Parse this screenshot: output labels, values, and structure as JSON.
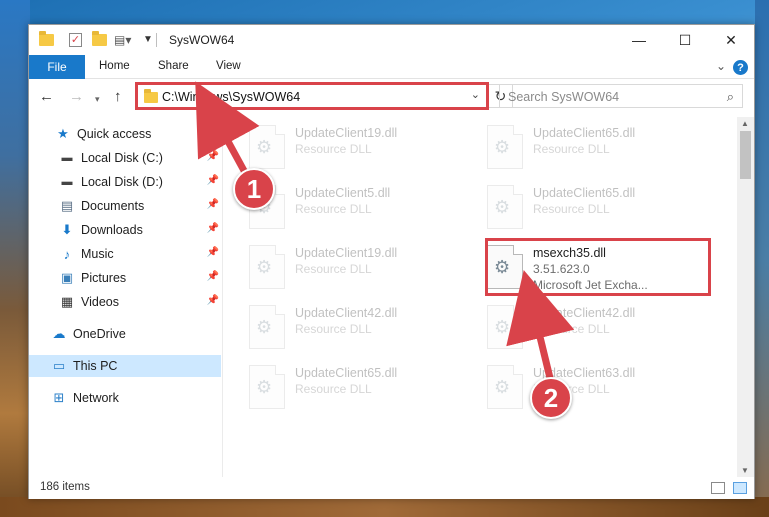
{
  "window": {
    "title": "SysWOW64",
    "controls": {
      "minimize": "—",
      "maximize": "☐",
      "close": "✕"
    }
  },
  "ribbon": {
    "tabs": [
      "File",
      "Home",
      "Share",
      "View"
    ],
    "help": "?"
  },
  "address_bar": {
    "path": "C:\\Windows\\SysWOW64",
    "search_placeholder": "Search SysWOW64"
  },
  "sidebar": {
    "items": [
      {
        "label": "Quick access",
        "icon": "star-icon"
      },
      {
        "label": "Local Disk (C:)",
        "icon": "drive-icon",
        "pinned": true
      },
      {
        "label": "Local Disk (D:)",
        "icon": "drive-icon",
        "pinned": true
      },
      {
        "label": "Documents",
        "icon": "documents-icon",
        "pinned": true
      },
      {
        "label": "Downloads",
        "icon": "download-icon",
        "pinned": true
      },
      {
        "label": "Music",
        "icon": "music-icon",
        "pinned": true
      },
      {
        "label": "Pictures",
        "icon": "pictures-icon",
        "pinned": true
      },
      {
        "label": "Videos",
        "icon": "videos-icon",
        "pinned": true
      },
      {
        "label": "OneDrive",
        "icon": "cloud-icon"
      },
      {
        "label": "This PC",
        "icon": "computer-icon",
        "selected": true
      },
      {
        "label": "Network",
        "icon": "network-icon"
      }
    ]
  },
  "files": [
    {
      "name": "UpdateClient19.dll",
      "type": "Resource DLL",
      "faded": true
    },
    {
      "name": "UpdateClient65.dll",
      "type": "Resource DLL",
      "faded": true
    },
    {
      "name": "UpdateClient5.dll",
      "type": "Resource DLL",
      "faded": true
    },
    {
      "name": "UpdateClient65.dll",
      "type": "Resource DLL",
      "faded": true
    },
    {
      "name": "UpdateClient19.dll",
      "type": "Resource DLL",
      "faded": true
    },
    {
      "name": "msexch35.dll",
      "version": "3.51.623.0",
      "type": "Microsoft Jet Excha...",
      "faded": false
    },
    {
      "name": "UpdateClient42.dll",
      "type": "Resource DLL",
      "faded": true
    },
    {
      "name": "UpdateClient42.dll",
      "type": "Resource DLL",
      "faded": true
    },
    {
      "name": "UpdateClient65.dll",
      "type": "Resource DLL",
      "faded": true
    },
    {
      "name": "UpdateClient63.dll",
      "type": "Resource DLL",
      "faded": true
    }
  ],
  "status": {
    "item_count": "186 items"
  },
  "callouts": {
    "step1": "1",
    "step2": "2",
    "highlight_color": "#d9434a"
  },
  "colors": {
    "accent": "#1979ca",
    "selection": "#cde8ff"
  }
}
